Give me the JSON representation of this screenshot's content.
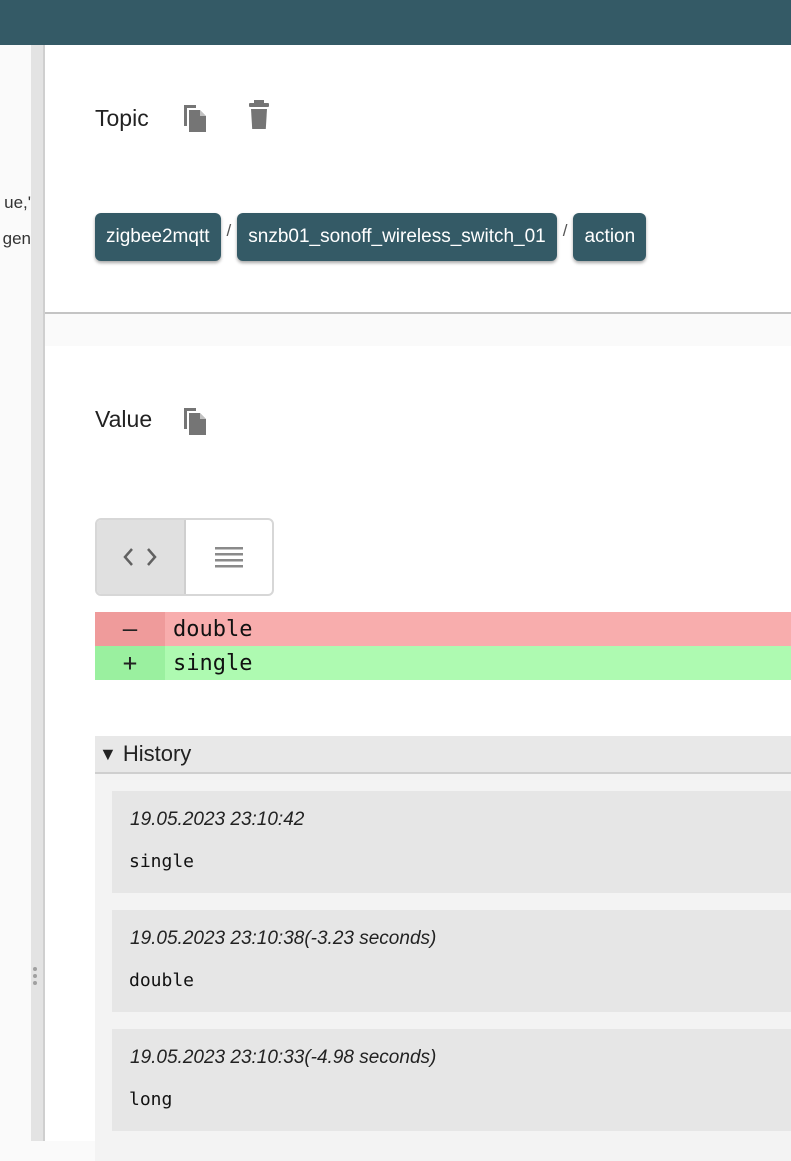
{
  "left_pane": {
    "fragments": [
      "ue,'",
      "gen"
    ]
  },
  "topic": {
    "title": "Topic",
    "copy_icon": "copy-icon",
    "delete_icon": "trash-icon",
    "chips": [
      "zigbee2mqtt",
      "snzb01_sonoff_wireless_switch_01",
      "action"
    ],
    "separator": "/"
  },
  "value": {
    "title": "Value",
    "copy_icon": "copy-icon",
    "view_toggle": {
      "options": [
        "code-view-icon",
        "text-view-icon"
      ],
      "active": "code-view-icon"
    },
    "diff": {
      "removed": {
        "sign": "–",
        "text": "double"
      },
      "added": {
        "sign": "+",
        "text": "single"
      }
    }
  },
  "history": {
    "title": "History",
    "expanded_marker": "▼",
    "entries": [
      {
        "timestamp": "19.05.2023 23:10:42",
        "value": "single"
      },
      {
        "timestamp": "19.05.2023 23:10:38(-3.23 seconds)",
        "value": "double"
      },
      {
        "timestamp": "19.05.2023 23:10:33(-4.98 seconds)",
        "value": "long"
      }
    ]
  },
  "colors": {
    "accent": "#345a66",
    "diff_removed": "#f8adad",
    "diff_added": "#aefab1"
  }
}
